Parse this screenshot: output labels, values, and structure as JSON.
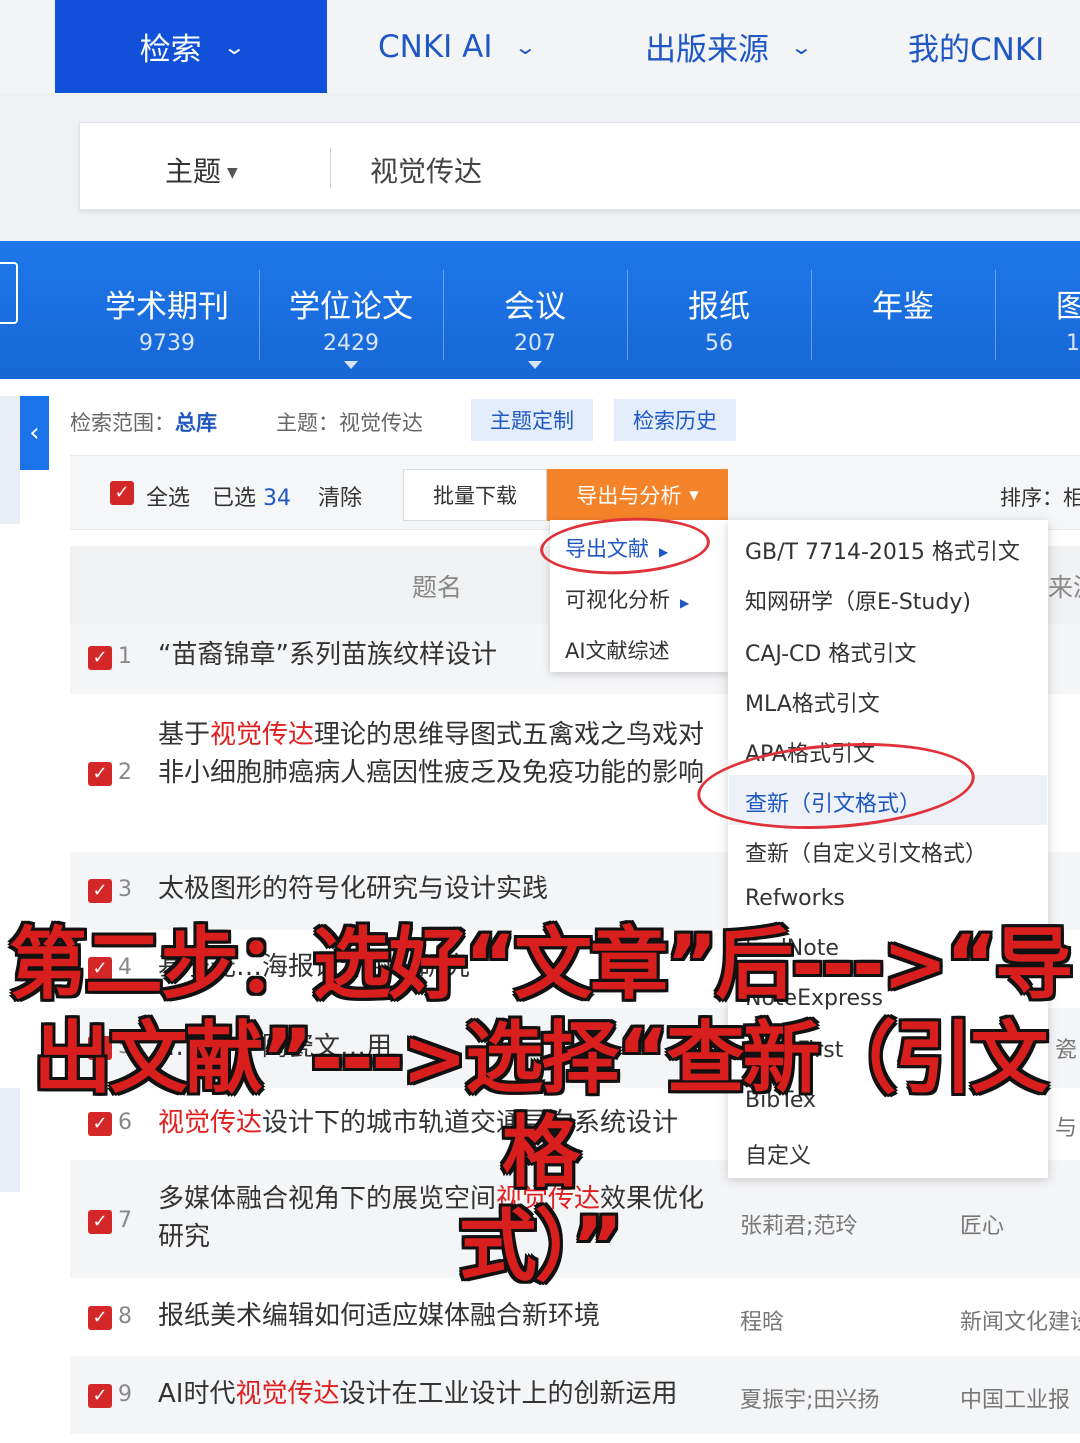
{
  "nav": {
    "items": [
      {
        "label": "检索",
        "active": true
      },
      {
        "label": "CNKI AI"
      },
      {
        "label": "出版来源"
      },
      {
        "label": "我的CNKI"
      }
    ]
  },
  "search": {
    "field": "主题",
    "value": "视觉传达"
  },
  "categories": [
    {
      "name": "学术期刊",
      "count": "9739"
    },
    {
      "name": "学位论文",
      "count": "2429"
    },
    {
      "name": "会议",
      "count": "207"
    },
    {
      "name": "报纸",
      "count": "56"
    },
    {
      "name": "年鉴",
      "count": ""
    },
    {
      "name": "图",
      "count": "1"
    }
  ],
  "scope": {
    "label": "检索范围：",
    "library": "总库",
    "topic": "主题：视觉传达",
    "btn_topic": "主题定制",
    "btn_history": "检索历史"
  },
  "toolbar": {
    "select_all": "全选",
    "selected_label": "已选",
    "selected_count": "34",
    "clear": "清除",
    "batch_download": "批量下载",
    "export_analysis": "导出与分析",
    "sort": "排序：相"
  },
  "table": {
    "header_title": "题名",
    "header_source": "来源",
    "rows": [
      {
        "num": "1",
        "title_parts": [
          "“苗裔锦章”系列苗族纹样设计"
        ],
        "author": "",
        "source": ""
      },
      {
        "num": "2",
        "title_a": "基于",
        "title_hl": "视觉传达",
        "title_b": "理论的思维导图式五禽戏之鸟戏对非小细胞肺癌病人癌因性疲乏及免疫功能的影响",
        "author": "",
        "source": ""
      },
      {
        "num": "3",
        "title": "太极图形的符号化研究与设计实践"
      },
      {
        "num": "4",
        "title": "基于元…海报设计中…研究"
      },
      {
        "num": "5",
        "title": "…设计中陶瓷文…用",
        "source": "瓷"
      },
      {
        "num": "6",
        "title_hl": "视觉传达",
        "title_b": "设计下的城市轨道交通导向系统设计",
        "source": "与"
      },
      {
        "num": "7",
        "title_a": "多媒体融合视角下的展览空间",
        "title_hl": "视觉传达",
        "title_b": "效果优化研究",
        "author": "张莉君;范玲",
        "source": "匠心"
      },
      {
        "num": "8",
        "title": "报纸美术编辑如何适应媒体融合新环境",
        "author": "程晗",
        "source": "新闻文化建设"
      },
      {
        "num": "9",
        "title_a": "AI时代",
        "title_hl": "视觉传达",
        "title_b": "设计在工业设计上的创新运用",
        "author": "夏振宇;田兴扬",
        "source": "中国工业报"
      }
    ]
  },
  "export_menu": {
    "items": [
      "导出文献",
      "可视化分析",
      "AI文献综述"
    ]
  },
  "format_menu": {
    "items": [
      "GB/T 7714-2015 格式引文",
      "知网研学（原E-Study)",
      "CAJ-CD 格式引文",
      "MLA格式引文",
      "APA格式引文",
      "查新（引文格式）",
      "查新（自定义引文格式）",
      "Refworks",
      "EndNote",
      "NoteExpress",
      "NoteFirst",
      "BibTex",
      "自定义"
    ]
  },
  "caption": {
    "line1": "第二步：选好“文章”后--->“导",
    "line2": "出文献”--->选择“查新（引文格",
    "line3": "式）”"
  },
  "colors": {
    "brand_blue": "#1150d9",
    "band_blue": "#1a73e8",
    "export_orange": "#f5832a",
    "highlight_red": "#e02020",
    "caption_red": "#d91e1e"
  }
}
